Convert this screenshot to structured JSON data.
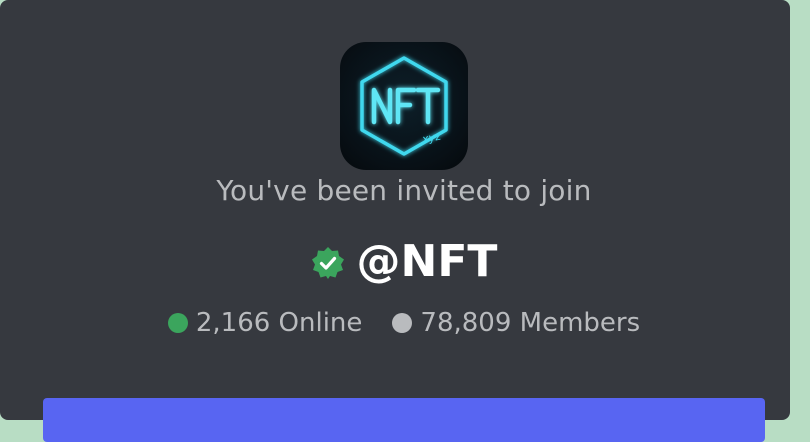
{
  "invite": {
    "server_icon": "nft-xyz-logo-icon",
    "icon_text": "NFT",
    "icon_subtext": "xyz",
    "subtitle": "You've been invited to join",
    "verified_icon": "verified-badge-icon",
    "server_name": "@NFT",
    "online_count": "2,166 Online",
    "member_count": "78,809 Members",
    "accept_button": "accept-invite-button"
  },
  "colors": {
    "background": "#36393f",
    "online": "#3ba55d",
    "members": "#b9bbbe",
    "verified": "#3ba55d",
    "button": "#5865f2",
    "icon_glow": "#3fd8ee"
  }
}
